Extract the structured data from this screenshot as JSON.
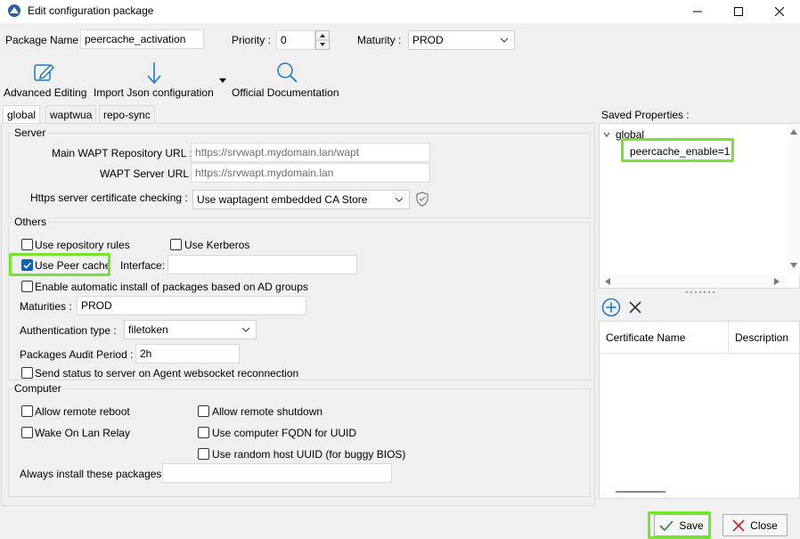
{
  "window": {
    "title": "Edit configuration package"
  },
  "header": {
    "package_name_label": "Package Name :",
    "package_name_value": "peercache_activation",
    "priority_label": "Priority :",
    "priority_value": "0",
    "maturity_label": "Maturity :",
    "maturity_value": "PROD"
  },
  "toolbar": {
    "advanced_editing": "Advanced Editing",
    "import_json": "Import Json configuration",
    "official_doc": "Official Documentation"
  },
  "tabs": [
    "global",
    "waptwua",
    "repo-sync"
  ],
  "server": {
    "title": "Server",
    "main_repo_label": "Main WAPT Repository URL :",
    "main_repo_placeholder": "https://srvwapt.mydomain.lan/wapt",
    "server_url_label": "WAPT Server URL :",
    "server_url_placeholder": "https://srvwapt.mydomain.lan",
    "https_check_label": "Https server certificate checking :",
    "https_check_value": "Use waptagent embedded CA Store"
  },
  "others": {
    "title": "Others",
    "use_repo_rules": "Use repository rules",
    "use_kerberos": "Use Kerberos",
    "use_peer_cache": "Use Peer cache",
    "interface_label": "Interface:",
    "interface_value": "",
    "auto_install_ad": "Enable automatic install of packages based on AD groups",
    "maturities_label": "Maturities :",
    "maturities_value": "PROD",
    "auth_type_label": "Authentication type :",
    "auth_type_value": "filetoken",
    "audit_period_label": "Packages Audit Period :",
    "audit_period_value": "2h",
    "send_status": "Send status to server on Agent websocket reconnection"
  },
  "computer": {
    "title": "Computer",
    "allow_reboot": "Allow remote reboot",
    "allow_shutdown": "Allow remote shutdown",
    "wol_relay": "Wake On Lan Relay",
    "fqdn_uuid": "Use computer FQDN for UUID",
    "random_uuid": "Use random host UUID (for buggy BIOS)",
    "always_install_label": "Always install these packages",
    "always_install_value": ""
  },
  "saved_properties": {
    "label": "Saved Properties :",
    "root": "global",
    "child": "peercache_enable=1"
  },
  "certificates": {
    "col_name": "Certificate Name",
    "col_desc": "Description"
  },
  "footer": {
    "save": "Save",
    "close": "Close"
  },
  "colors": {
    "highlight": "#74e42c",
    "accent": "#1062b8"
  },
  "state": {
    "use_peer_cache_checked": true
  }
}
